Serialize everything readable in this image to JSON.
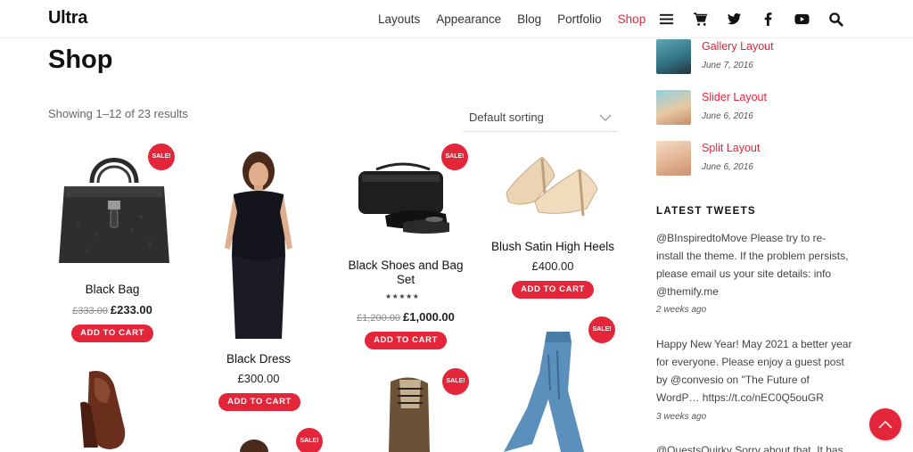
{
  "site": {
    "logo": "Ultra"
  },
  "nav": {
    "items": [
      "Layouts",
      "Appearance",
      "Blog",
      "Portfolio",
      "Shop"
    ],
    "active": "Shop"
  },
  "header_icons": [
    "menu-icon",
    "cart-icon",
    "twitter-icon",
    "facebook-icon",
    "youtube-icon",
    "search-icon"
  ],
  "page": {
    "title": "Shop",
    "result_count": "Showing 1–12 of 23 results",
    "sorting": "Default sorting"
  },
  "products": [
    {
      "name": "Black Bag",
      "old_price": "£333.00",
      "price": "£233.00",
      "button": "ADD TO CART",
      "sale": "SALE!"
    },
    {
      "name": "Black Dress",
      "price": "£300.00",
      "button": "ADD TO CART"
    },
    {
      "name": "Black Shoes and Bag Set",
      "old_price": "£1,200.00",
      "price": "£1,000.00",
      "button": "ADD TO CART",
      "sale": "SALE!",
      "rating": "★★★★★"
    },
    {
      "name": "Blush Satin High Heels",
      "price": "£400.00",
      "button": "ADD TO CART"
    },
    {
      "sale": "SALE!"
    },
    {
      "sale": "SALE!"
    },
    {
      "sale": "SALE!"
    }
  ],
  "sidebar": {
    "recent_posts": [
      {
        "title": "Gallery Layout",
        "date": "June 7, 2016"
      },
      {
        "title": "Slider Layout",
        "date": "June 6, 2016"
      },
      {
        "title": "Split Layout",
        "date": "June 6, 2016"
      }
    ],
    "tweets_title": "LATEST TWEETS",
    "tweets": [
      {
        "text": "@BInspiredtoMove Please try to re-install the theme. If the problem persists, please email us your site details: info @themify.me",
        "time": "2 weeks ago"
      },
      {
        "text": "Happy New Year! May 2021 a better year for everyone. Please enjoy a guest post by @convesio on \"The Future of WordP… https://t.co/nEC0Q5ouGR",
        "time": "3 weeks ago"
      },
      {
        "text": "@QuestsQuirky Sorry about that. It has"
      }
    ]
  },
  "colors": {
    "accent": "#e3263a"
  }
}
